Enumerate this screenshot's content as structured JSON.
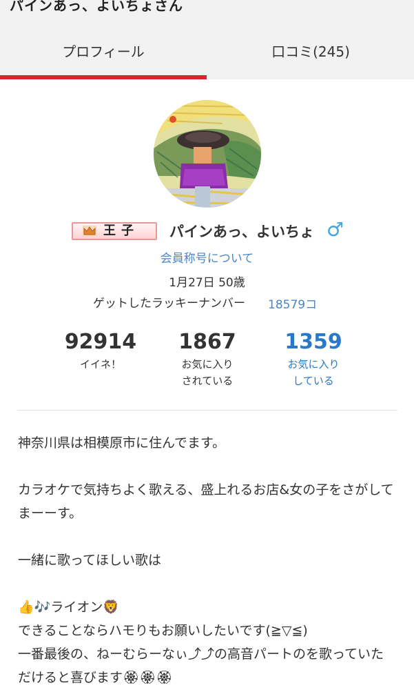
{
  "header": {
    "title": "パインあっ、よいちょさん",
    "tabs": [
      {
        "label": "プロフィール"
      },
      {
        "label": "口コミ(245)"
      }
    ]
  },
  "profile": {
    "rank": "王子",
    "nickname": "パインあっ、よいちょ",
    "gender_symbol": "♂",
    "member_title_link": "会員称号について",
    "birthday_age": "1月27日 50歳",
    "lucky_number_label": "ゲットしたラッキーナンバー",
    "lucky_number_value": "18579コ"
  },
  "stats": [
    {
      "value": "92914",
      "label": "イイネ！"
    },
    {
      "value": "1867",
      "label": "お気に入り\nされている"
    },
    {
      "value": "1359",
      "label": "お気に入り\nしている"
    }
  ],
  "intro": {
    "p1": "神奈川県は相模原市に住んでます。",
    "p2": "カラオケで気持ちよく歌える、盛上れるお店&女の子をさがしてまーーす。",
    "p3": "一緒に歌ってほしい歌は",
    "p4_line1": "👍🎶ライオン🦁",
    "p4_line2": "できることならハモりもお願いしたいです(≧▽≦)",
    "p4_line3": "一番最後の、ねーむらーなぃ⤴︎⤴︎の高音パートのを歌っていただけると喜びます🏵🏵🏵"
  },
  "colors": {
    "accent_red": "#d8262d",
    "link_blue": "#4a86c5",
    "stat_blue": "#2a79c8",
    "male_blue": "#44a6dc"
  }
}
